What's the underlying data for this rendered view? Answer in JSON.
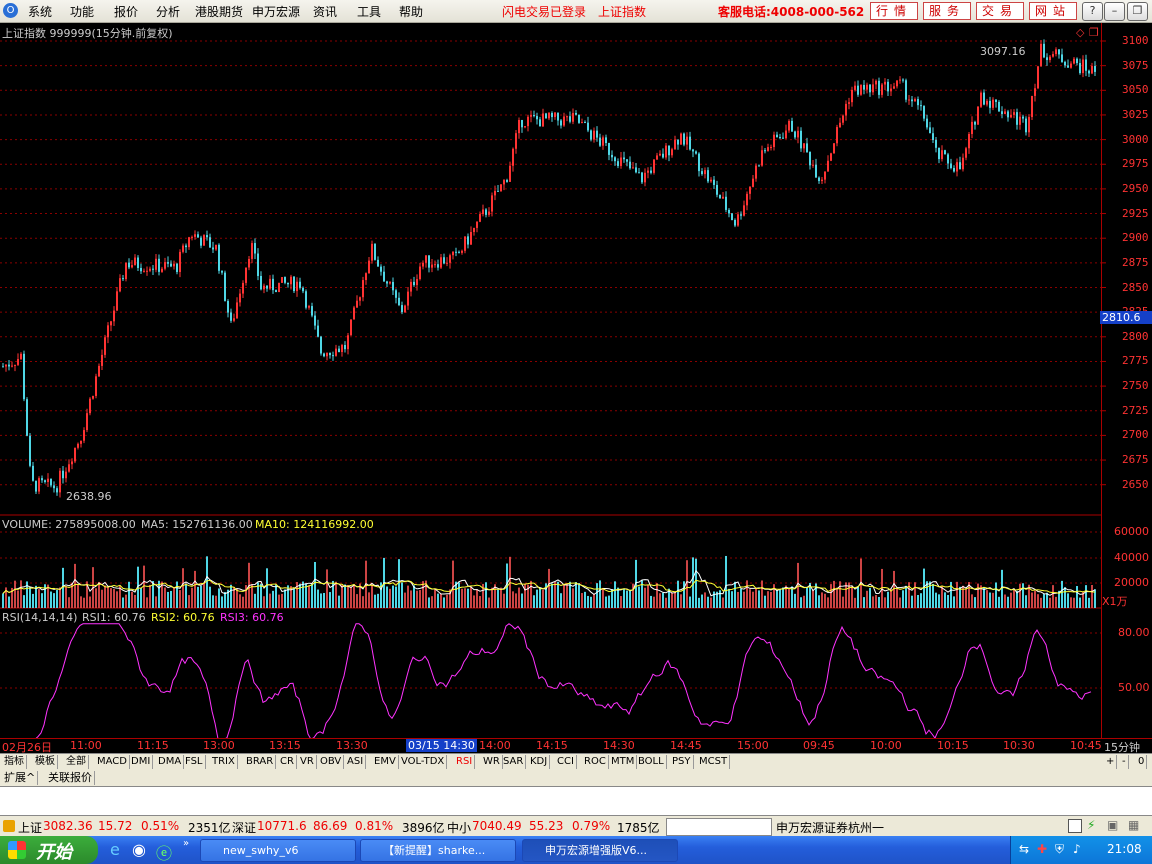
{
  "menubar": {
    "items": [
      "系统",
      "功能",
      "报价",
      "分析",
      "港股期货",
      "申万宏源",
      "资讯",
      "工具",
      "帮助"
    ],
    "status_login": "闪电交易已登录",
    "status_index": "上证指数",
    "hotline": "客服电话:4008-000-562",
    "buttons": [
      "行情",
      "服务",
      "交易",
      "网站"
    ]
  },
  "chart": {
    "title": "上证指数 999999(15分钟.前复权)",
    "high_label": "3097.16",
    "low_label": "2638.96",
    "current_price": "2810.6",
    "price_ticks": [
      "3100",
      "3075",
      "3050",
      "3025",
      "3000",
      "2975",
      "2950",
      "2925",
      "2900",
      "2875",
      "2850",
      "2825",
      "2800",
      "2775",
      "2750",
      "2725",
      "2700",
      "2675",
      "2650"
    ],
    "volume_label": "VOLUME: 275895008.00",
    "ma5_label": "MA5: 152761136.00",
    "ma10_label": "MA10: 124116992.00",
    "volume_ticks": [
      "60000",
      "40000",
      "20000"
    ],
    "volume_unit": "X1万",
    "rsi_label": "RSI(14,14,14)",
    "rsi1": "RSI1: 60.76",
    "rsi2": "RSI2: 60.76",
    "rsi3": "RSI3: 60.76",
    "rsi_ticks": [
      "80.00",
      "50.00"
    ],
    "time_labels": [
      "02月26日",
      "11:00",
      "11:15",
      "13:00",
      "13:15",
      "13:30",
      "03/15 14:30",
      "14:00",
      "14:15",
      "14:30",
      "14:45",
      "15:00",
      "09:45",
      "10:00",
      "10:15",
      "10:30",
      "10:45"
    ],
    "period": "15分钟"
  },
  "indicator_tabs": [
    "指标",
    "模板",
    "全部",
    "MACD",
    "DMI",
    "DMA",
    "FSL",
    "TRIX",
    "BRAR",
    "CR",
    "VR",
    "OBV",
    "ASI",
    "EMV",
    "VOL-TDX",
    "RSI",
    "WR",
    "SAR",
    "KDJ",
    "CCI",
    "ROC",
    "MTM",
    "BOLL",
    "PSY",
    "MCST"
  ],
  "indicator_tab_active": "RSI",
  "indicator_controls": [
    "+",
    "-",
    "0"
  ],
  "ext_tabs": [
    "扩展^",
    "关联报价"
  ],
  "statusbar": {
    "sh_name": "上证",
    "sh_price": "3082.36",
    "sh_chg": "15.72",
    "sh_pct": "0.51%",
    "sh_amt": "2351亿",
    "sz_name": "深证",
    "sz_price": "10771.6",
    "sz_chg": "86.69",
    "sz_pct": "0.81%",
    "sz_amt": "3896亿",
    "zx_name": "中小",
    "zx_price": "7040.49",
    "zx_chg": "55.23",
    "zx_pct": "0.79%",
    "zx_amt": "1785亿",
    "broker": "申万宏源证券杭州一"
  },
  "taskbar": {
    "start": "开始",
    "tasks": [
      "new_swhy_v6",
      "【新提醒】sharke...",
      "申万宏源增强版V6..."
    ],
    "clock": "21:08"
  },
  "colors": {
    "up": "#ff3333",
    "down": "#4fd7e6",
    "ma5": "#ffffff",
    "ma10": "#ffff33",
    "rsi": "#ff33ff",
    "grid": "#8a0000"
  }
}
